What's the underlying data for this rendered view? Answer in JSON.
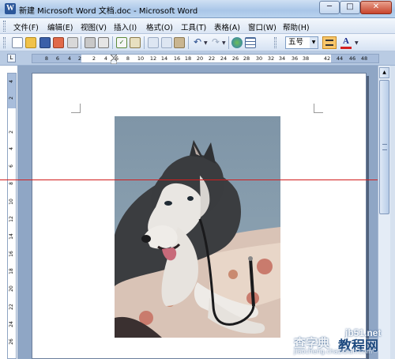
{
  "window": {
    "title": "新建 Microsoft Word 文档.doc - Microsoft Word",
    "icon": "word-app-icon",
    "controls": [
      "minimize-icon",
      "maximize-icon",
      "close-icon"
    ]
  },
  "menu": {
    "items": [
      {
        "label": "文件(F)"
      },
      {
        "label": "编辑(E)"
      },
      {
        "label": "视图(V)"
      },
      {
        "label": "插入(I)"
      },
      {
        "label": "格式(O)"
      },
      {
        "label": "工具(T)"
      },
      {
        "label": "表格(A)"
      },
      {
        "label": "窗口(W)"
      },
      {
        "label": "帮助(H)"
      }
    ]
  },
  "toolbar": {
    "font_size": "五号",
    "icons": [
      "new-document-icon",
      "open-folder-icon",
      "save-icon",
      "permission-icon",
      "email-icon",
      "print-icon",
      "print-preview-icon",
      "spelling-icon",
      "research-icon",
      "cut-icon",
      "copy-icon",
      "paste-icon",
      "undo-icon",
      "redo-icon",
      "hyperlink-icon",
      "table-icon",
      "align-center-icon",
      "font-color-icon"
    ],
    "font_color_letter": "A",
    "font_color": "#d42020"
  },
  "ruler": {
    "corner_label": "L",
    "horizontal_numbers": [
      "8",
      "6",
      "4",
      "2",
      "2",
      "4",
      "6",
      "8",
      "10",
      "12",
      "14",
      "16",
      "18",
      "20",
      "22",
      "24",
      "26",
      "28",
      "30",
      "32",
      "34",
      "36",
      "38",
      "42",
      "44",
      "46",
      "48"
    ],
    "vertical_numbers": [
      "4",
      "2",
      "2",
      "4",
      "6",
      "8",
      "10",
      "12",
      "14",
      "16",
      "18",
      "20",
      "22",
      "24",
      "26"
    ]
  },
  "document": {
    "image": "husky-dog-photo"
  },
  "watermark": {
    "domain": "jb51.net",
    "site_left": "查字典",
    "site_right": "教程网",
    "subtitle": "jiaocheng.chazidian.com"
  }
}
